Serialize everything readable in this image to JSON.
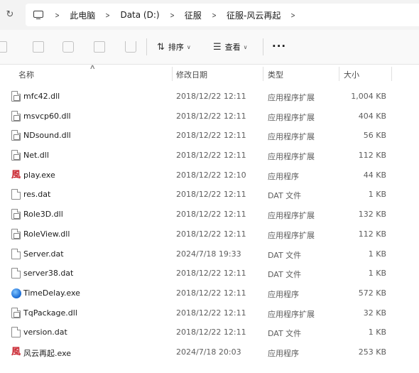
{
  "address": {
    "crumbs": [
      "此电脑",
      "Data (D:)",
      "征服",
      "征服-风云再起"
    ]
  },
  "toolbar": {
    "sort_label": "排序",
    "view_label": "查看",
    "more_label": "···"
  },
  "columns": {
    "name": "名称",
    "date": "修改日期",
    "type": "类型",
    "size": "大小"
  },
  "files": [
    {
      "name": "mfc42.dll",
      "date": "2018/12/22 12:11",
      "type": "应用程序扩展",
      "size": "1,004 KB",
      "icon": "dll-icon"
    },
    {
      "name": "msvcp60.dll",
      "date": "2018/12/22 12:11",
      "type": "应用程序扩展",
      "size": "404 KB",
      "icon": "dll-icon"
    },
    {
      "name": "NDsound.dll",
      "date": "2018/12/22 12:11",
      "type": "应用程序扩展",
      "size": "56 KB",
      "icon": "dll-icon"
    },
    {
      "name": "Net.dll",
      "date": "2018/12/22 12:11",
      "type": "应用程序扩展",
      "size": "112 KB",
      "icon": "dll-icon"
    },
    {
      "name": "play.exe",
      "date": "2018/12/22 12:10",
      "type": "应用程序",
      "size": "44 KB",
      "icon": "app-red-icon"
    },
    {
      "name": "res.dat",
      "date": "2018/12/22 12:11",
      "type": "DAT 文件",
      "size": "1 KB",
      "icon": "file-icon"
    },
    {
      "name": "Role3D.dll",
      "date": "2018/12/22 12:11",
      "type": "应用程序扩展",
      "size": "132 KB",
      "icon": "dll-icon"
    },
    {
      "name": "RoleView.dll",
      "date": "2018/12/22 12:11",
      "type": "应用程序扩展",
      "size": "112 KB",
      "icon": "dll-icon"
    },
    {
      "name": "Server.dat",
      "date": "2024/7/18 19:33",
      "type": "DAT 文件",
      "size": "1 KB",
      "icon": "file-icon"
    },
    {
      "name": "server38.dat",
      "date": "2018/12/22 12:11",
      "type": "DAT 文件",
      "size": "1 KB",
      "icon": "file-icon"
    },
    {
      "name": "TimeDelay.exe",
      "date": "2018/12/22 12:11",
      "type": "应用程序",
      "size": "572 KB",
      "icon": "globe-icon"
    },
    {
      "name": "TqPackage.dll",
      "date": "2018/12/22 12:11",
      "type": "应用程序扩展",
      "size": "32 KB",
      "icon": "dll-icon"
    },
    {
      "name": "version.dat",
      "date": "2018/12/22 12:11",
      "type": "DAT 文件",
      "size": "1 KB",
      "icon": "file-icon"
    },
    {
      "name": "风云再起.exe",
      "date": "2024/7/18 20:03",
      "type": "应用程序",
      "size": "253 KB",
      "icon": "app-red-icon"
    }
  ]
}
